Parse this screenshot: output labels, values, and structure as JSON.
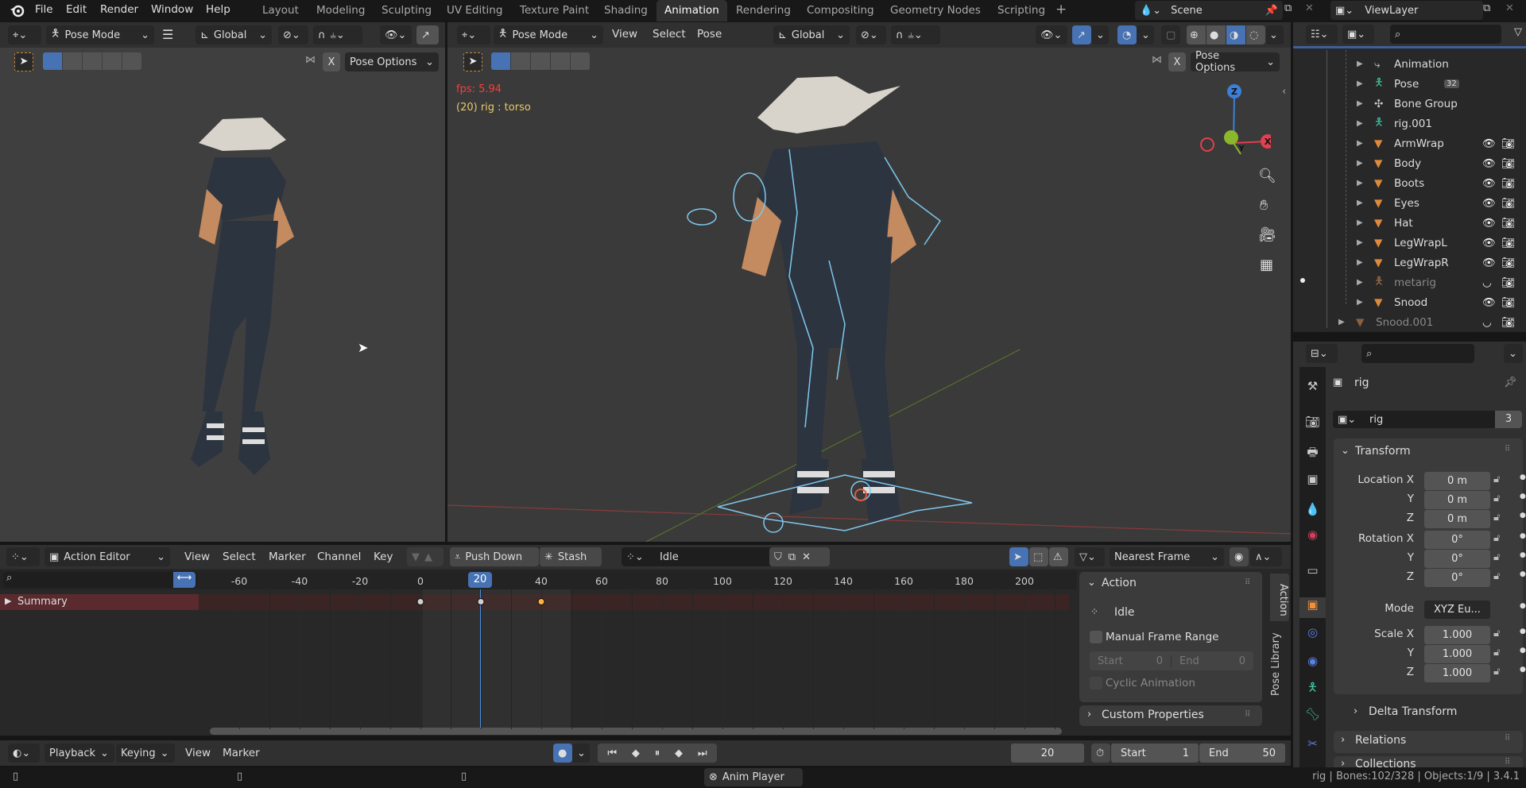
{
  "topbar": {
    "menus": [
      "File",
      "Edit",
      "Render",
      "Window",
      "Help"
    ],
    "workspaces": [
      "Layout",
      "Modeling",
      "Sculpting",
      "UV Editing",
      "Texture Paint",
      "Shading",
      "Animation",
      "Rendering",
      "Compositing",
      "Geometry Nodes",
      "Scripting"
    ],
    "active_workspace": "Animation",
    "add_workspace": "+",
    "scene": "Scene",
    "view_layer": "ViewLayer"
  },
  "left_viewport": {
    "mode": "Pose Mode",
    "orientation": "Global",
    "mirror_x": "X",
    "pose_options": "Pose Options"
  },
  "main_viewport": {
    "mode": "Pose Mode",
    "menus": [
      "View",
      "Select",
      "Pose"
    ],
    "orientation": "Global",
    "mirror_x": "X",
    "pose_options": "Pose Options",
    "fps": "fps: 5.94",
    "active_info": "(20) rig : torso",
    "gizmo": {
      "z": "Z",
      "y": "Y",
      "x": "X"
    },
    "colors": {
      "x": "#e0404f",
      "y": "#8ab82a",
      "z": "#3d7fd6"
    }
  },
  "outliner": {
    "items": [
      {
        "name": "Animation",
        "icon": "action-icon",
        "type": "data"
      },
      {
        "name": "Pose",
        "icon": "pose-icon",
        "type": "data",
        "badge": "32"
      },
      {
        "name": "Bone Group",
        "icon": "bone-group-icon",
        "type": "data"
      },
      {
        "name": "rig.001",
        "icon": "armature-icon",
        "type": "data"
      },
      {
        "name": "ArmWrap",
        "icon": "mesh-icon",
        "type": "mesh",
        "visible": true
      },
      {
        "name": "Body",
        "icon": "mesh-icon",
        "type": "mesh",
        "visible": true
      },
      {
        "name": "Boots",
        "icon": "mesh-icon",
        "type": "mesh",
        "visible": true
      },
      {
        "name": "Eyes",
        "icon": "mesh-icon",
        "type": "mesh",
        "visible": true
      },
      {
        "name": "Hat",
        "icon": "mesh-icon",
        "type": "mesh",
        "visible": true
      },
      {
        "name": "LegWrapL",
        "icon": "mesh-icon",
        "type": "mesh",
        "visible": true
      },
      {
        "name": "LegWrapR",
        "icon": "mesh-icon",
        "type": "mesh",
        "visible": true
      },
      {
        "name": "metarig",
        "icon": "armature-icon",
        "type": "armature",
        "visible": false
      },
      {
        "name": "Snood",
        "icon": "mesh-icon",
        "type": "mesh",
        "visible": true
      },
      {
        "name": "Snood.001",
        "icon": "mesh-icon",
        "type": "mesh",
        "visible": false
      }
    ]
  },
  "properties": {
    "object_name": "rig",
    "data_name": "rig",
    "users": "3",
    "transform_title": "Transform",
    "location": {
      "label": "Location X",
      "values": [
        "0 m",
        "0 m",
        "0 m"
      ]
    },
    "rotation": {
      "label": "Rotation X",
      "values": [
        "0°",
        "0°",
        "0°"
      ]
    },
    "mode_label": "Mode",
    "mode_value": "XYZ Eu...",
    "scale": {
      "label": "Scale X",
      "values": [
        "1.000",
        "1.000",
        "1.000"
      ]
    },
    "axis_labels": [
      "Y",
      "Z"
    ],
    "delta_transform": "Delta Transform",
    "relations": "Relations",
    "collections": "Collections"
  },
  "action_editor": {
    "editor_mode": "Action Editor",
    "menus": [
      "View",
      "Select",
      "Marker",
      "Channel",
      "Key"
    ],
    "push_down": "Push Down",
    "stash": "Stash",
    "action_name": "Idle",
    "snapping": "Nearest Frame",
    "ruler_ticks": [
      -60,
      -40,
      -20,
      0,
      20,
      40,
      60,
      80,
      100,
      120,
      140,
      160,
      180,
      200
    ],
    "current_frame": "20",
    "channel": "Summary",
    "keyframes": [
      {
        "frame": 0,
        "selected": false
      },
      {
        "frame": 20,
        "selected": false
      },
      {
        "frame": 40,
        "selected": true
      }
    ],
    "sidebar": {
      "action_panel": "Action",
      "action_name": "Idle",
      "manual_frame_range": "Manual Frame Range",
      "manual_frame_range_checked": false,
      "start_label": "Start",
      "start_value": "0",
      "end_label": "End",
      "end_value": "0",
      "cyclic": "Cyclic Animation",
      "custom_properties": "Custom Properties",
      "tabs": [
        "Action",
        "Pose Library"
      ]
    }
  },
  "timeline": {
    "menus": [
      "Playback",
      "Keying",
      "View",
      "Marker"
    ],
    "current_frame": "20",
    "start_label": "Start",
    "start_value": "1",
    "end_label": "End",
    "end_value": "50"
  },
  "statusbar": {
    "center": "Anim Player",
    "right": "rig | Bones:102/328 | Objects:1/9 | 3.4.1"
  }
}
